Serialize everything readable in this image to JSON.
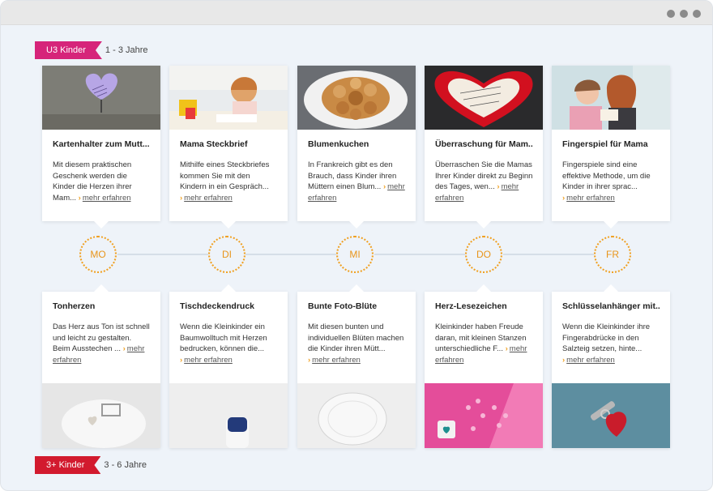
{
  "colors": {
    "u3": "#d6247a",
    "kinder3": "#d21a2e",
    "accent": "#f0a020"
  },
  "age_groups": {
    "top": {
      "tag": "U3 Kinder",
      "range": "1 - 3 Jahre"
    },
    "bottom": {
      "tag": "3+ Kinder",
      "range": "3 - 6 Jahre"
    }
  },
  "more_label": "mehr erfahren",
  "days": [
    "MO",
    "DI",
    "MI",
    "DO",
    "FR"
  ],
  "top_cards": [
    {
      "title": "Kartenhalter zum Mutt...",
      "desc": "Mit diesem praktischen Geschenk werden die Kinder die Herzen ihrer Mam...",
      "image": "heart-card-holder-photo"
    },
    {
      "title": "Mama Steckbrief",
      "desc": "Mithilfe eines Steckbriefes kommen Sie mit den Kindern in ein Gespräch...",
      "image": "girl-drawing-photo"
    },
    {
      "title": "Blumenkuchen",
      "desc": "In Frankreich gibt es den Brauch, dass Kinder ihren Müttern einen Blum...",
      "image": "flower-cake-photo"
    },
    {
      "title": "Überraschung für Mam...",
      "desc": "Überraschen Sie die Mamas Ihrer Kinder direkt zu Beginn des Tages, wen...",
      "image": "rose-heart-photo"
    },
    {
      "title": "Fingerspiel für Mama",
      "desc": "Fingerspiele sind eine effektive Methode, um die Kinder in ihrer sprac...",
      "image": "mother-child-photo"
    }
  ],
  "bottom_cards": [
    {
      "title": "Tonherzen",
      "desc": "Das Herz aus Ton ist schnell und leicht zu gestalten. Beim Ausstechen ...",
      "image": "clay-heart-photo"
    },
    {
      "title": "Tischdeckendruck",
      "desc": "Wenn die Kleinkinder ein Baumwolltuch mit Herzen bedrucken, können die...",
      "image": "paint-bottle-photo"
    },
    {
      "title": "Bunte Foto-Blüte",
      "desc": "Mit diesen bunten und individuellen Blüten machen die Kinder ihren Mütt...",
      "image": "paper-plate-photo"
    },
    {
      "title": "Herz-Lesezeichen",
      "desc": "Kleinkinder haben Freude daran, mit kleinen Stanzen unterschiedliche F...",
      "image": "heart-confetti-photo"
    },
    {
      "title": "Schlüsselanhänger mit...",
      "desc": "Wenn die Kleinkinder ihre Fingerabdrücke in den Salzteig setzen, hinte...",
      "image": "key-heart-photo"
    }
  ]
}
